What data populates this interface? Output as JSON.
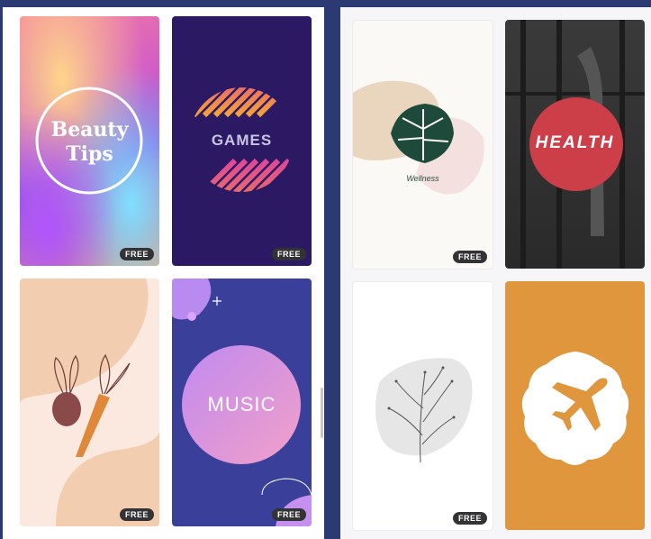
{
  "templates": {
    "beauty": {
      "title_line1": "Beauty",
      "title_line2": "Tips",
      "badge": "FREE"
    },
    "games": {
      "title": "GAMES",
      "badge": "FREE"
    },
    "wellness": {
      "title": "Wellness",
      "badge": "FREE"
    },
    "health": {
      "title": "HEALTH"
    },
    "veggies": {
      "badge": "FREE"
    },
    "music": {
      "title": "MUSIC",
      "badge": "FREE"
    },
    "plant": {
      "badge": "FREE"
    },
    "travel": {}
  },
  "icons": {
    "monstera": "monstera-leaf-icon",
    "plant": "plant-sprig-icon",
    "airplane": "airplane-icon",
    "veggies": "beet-carrot-icon"
  },
  "colors": {
    "background": "#2c3a73",
    "games_bg": "#2b1963",
    "health_circle": "#cc3f48",
    "travel_bg": "#e0963c",
    "music_bg": "#3a3f9a",
    "badge": "#333336"
  }
}
